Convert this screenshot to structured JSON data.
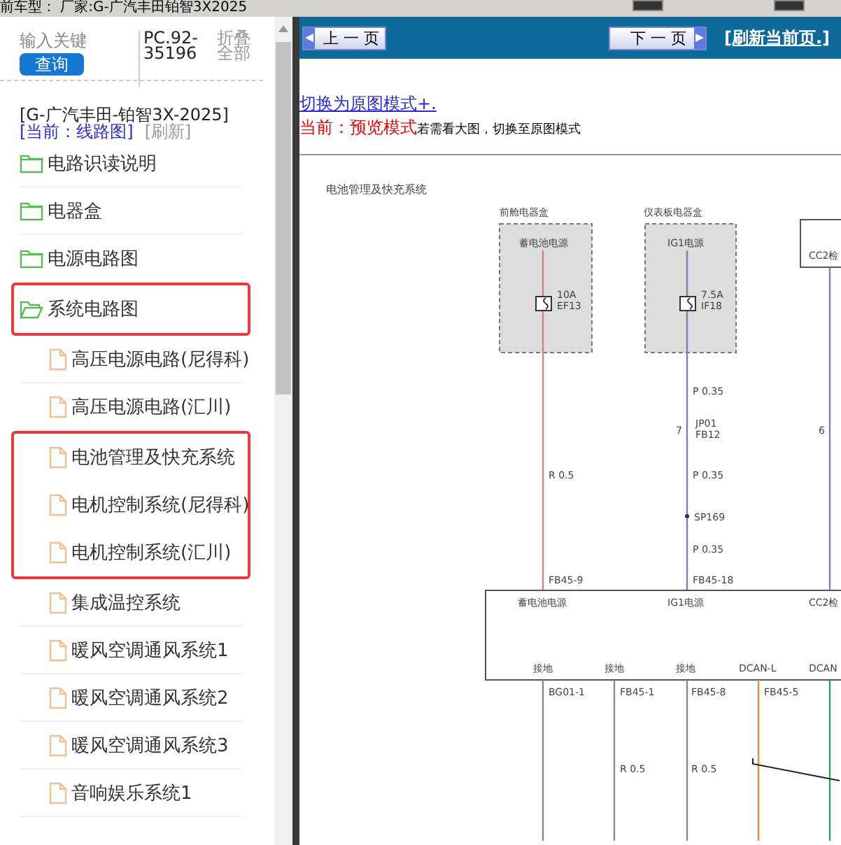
{
  "top_bar": {
    "text": "前车型： 厂家:G-广汽丰田铂智3X2025"
  },
  "search": {
    "label": "输入关键",
    "button": "查询",
    "code": "PC.92-35196",
    "collapse_all": "折叠全部"
  },
  "model": {
    "name": "[G-广汽丰田-铂智3X-2025]",
    "current": "[当前：线路图]",
    "refresh": "[刷新]"
  },
  "tree": [
    {
      "label": "电路识读说明",
      "expanded": false,
      "marked": false
    },
    {
      "label": "电器盒",
      "expanded": false,
      "marked": false
    },
    {
      "label": "电源电路图",
      "expanded": false,
      "marked": false
    },
    {
      "label": "系统电路图",
      "expanded": true,
      "marked": true,
      "children": [
        {
          "label": "高压电源电路(尼得科)",
          "marked": false
        },
        {
          "label": "高压电源电路(汇川)",
          "marked": false
        },
        {
          "label": "电池管理及快充系统",
          "marked": true
        },
        {
          "label": "电机控制系统(尼得科)",
          "marked": true
        },
        {
          "label": "电机控制系统(汇川)",
          "marked": true
        },
        {
          "label": "集成温控系统",
          "marked": false
        },
        {
          "label": "暖风空调通风系统1",
          "marked": false
        },
        {
          "label": "暖风空调通风系统2",
          "marked": false
        },
        {
          "label": "暖风空调通风系统3",
          "marked": false
        },
        {
          "label": "音响娱乐系统1",
          "marked": false
        }
      ]
    }
  ],
  "toolbar": {
    "prev": "上 一 页",
    "next": "下 一 页",
    "refresh": "[刷新当前页.]"
  },
  "mode": {
    "switch_link": "切换为原图模式+.",
    "current_label": "当前：预览模式",
    "hint": "若需看大图，切换至原图模式"
  },
  "diagram": {
    "title": "电池管理及快充系统",
    "labels": [
      "前舱电器盒",
      "仪表板电器盒",
      "蓄电池电源",
      "IG1电源",
      "10A",
      "EF13",
      "7.5A",
      "IF18",
      "CC2检",
      "P 0.35",
      "7",
      "JP01",
      "FB12",
      "6",
      "R 0.5",
      "P 0.35",
      "SP169",
      "P 0.35",
      "FB45-9",
      "FB45-18",
      "蓄电池电源",
      "IG1电源",
      "CC2检",
      "接地",
      "接地",
      "接地",
      "DCAN-L",
      "DCAN",
      "BG01-1",
      "FB45-1",
      "FB45-8",
      "FB45-5",
      "R 0.5",
      "R 0.5"
    ]
  }
}
